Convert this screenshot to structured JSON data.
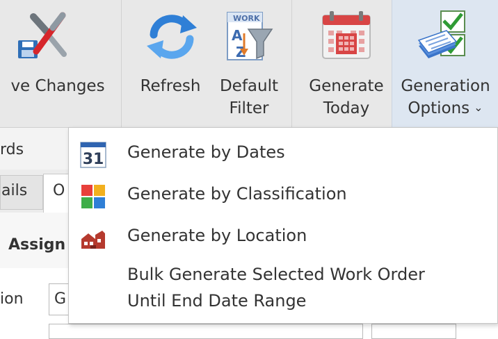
{
  "ribbon": {
    "save_changes": "ve Changes",
    "refresh": "Refresh",
    "default_filter_line1": "Default",
    "default_filter_line2": "Filter",
    "generate_today_line1": "Generate",
    "generate_today_line2": "Today",
    "generation_options_line1": "Generation",
    "generation_options_line2": "Options"
  },
  "background": {
    "records_fragment": "rds",
    "details_tab_fragment": "ails",
    "other_tab_fragment": "O",
    "section_fragment": "Assign",
    "field_label_fragment": "ion",
    "field_value_fragment": "G"
  },
  "menu": {
    "items": [
      {
        "label": "Generate by Dates",
        "icon": "calendar-31-icon",
        "icon_text": "31"
      },
      {
        "label": "Generate by Classification",
        "icon": "classification-grid-icon"
      },
      {
        "label": "Generate by Location",
        "icon": "location-building-icon"
      },
      {
        "label_line1": "Bulk Generate Selected Work Order",
        "label_line2": "Until End Date Range"
      }
    ]
  },
  "colors": {
    "ribbon_bg": "#e8e8e8",
    "active_button_bg": "#dde6f1",
    "menu_bg": "#ffffff",
    "text": "#333333"
  }
}
